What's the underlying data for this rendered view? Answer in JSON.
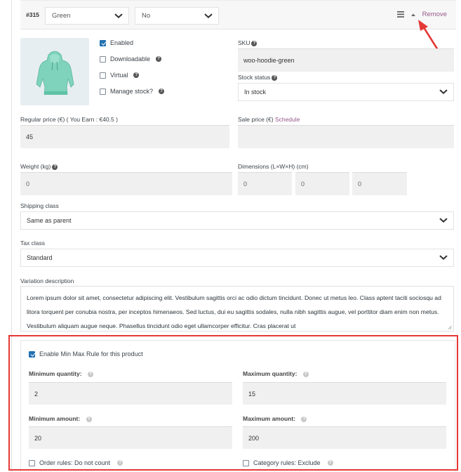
{
  "variation": {
    "id": "#315",
    "attribute_color": "Green",
    "attribute_second": "No",
    "remove_label": "Remove",
    "menu_icon": "hamburger-icon",
    "toggle_icon": "caret-up-icon"
  },
  "options": {
    "enabled": {
      "label": "Enabled",
      "checked": true
    },
    "downloadable": {
      "label": "Downloadable",
      "checked": false
    },
    "virtual": {
      "label": "Virtual",
      "checked": false
    },
    "manage_stock": {
      "label": "Manage stock?",
      "checked": false
    }
  },
  "fields": {
    "sku_label": "SKU",
    "sku_value": "woo-hoodie-green",
    "stock_status_label": "Stock status",
    "stock_status_value": "In stock",
    "regular_price_label": "Regular price (€) ( You Earn : €40.5 )",
    "regular_price_value": "45",
    "sale_price_label": "Sale price (€)",
    "sale_schedule_link": "Schedule",
    "sale_price_value": "",
    "weight_label": "Weight (kg)",
    "weight_placeholder": "0",
    "dimensions_label": "Dimensions (L×W×H) (cm)",
    "dim_length_placeholder": "0",
    "dim_width_placeholder": "0",
    "dim_height_placeholder": "0",
    "shipping_class_label": "Shipping class",
    "shipping_class_value": "Same as parent",
    "tax_class_label": "Tax class",
    "tax_class_value": "Standard",
    "description_label": "Variation description",
    "description_value": "Lorem ipsum dolor sit amet, consectetur adipiscing elit. Vestibulum sagittis orci ac odio dictum tincidunt. Donec ut metus leo. Class aptent taciti sociosqu ad litora torquent per conubia nostra, per inceptos himenaeos. Sed luctus, dui eu sagittis sodales, nulla nibh sagittis augue, vel porttitor diam enim non metus. Vestibulum aliquam augue neque. Phasellus tincidunt odio eget ullamcorper efficitur. Cras placerat ut"
  },
  "minmax": {
    "enable_label": "Enable Min Max Rule for this product",
    "enable_checked": true,
    "min_qty_label": "Minimum quantity:",
    "min_qty_value": "2",
    "max_qty_label": "Maximum quantity:",
    "max_qty_value": "15",
    "min_amount_label": "Minimum amount:",
    "min_amount_value": "20",
    "max_amount_label": "Maximum amount:",
    "max_amount_value": "200",
    "order_rules_label": "Order rules: Do not count",
    "order_rules_checked": false,
    "category_rules_label": "Category rules: Exclude",
    "category_rules_checked": false
  },
  "colors": {
    "accent_link": "#96588a",
    "highlight_border": "#e53935",
    "checkbox_checked": "#2271b1"
  }
}
